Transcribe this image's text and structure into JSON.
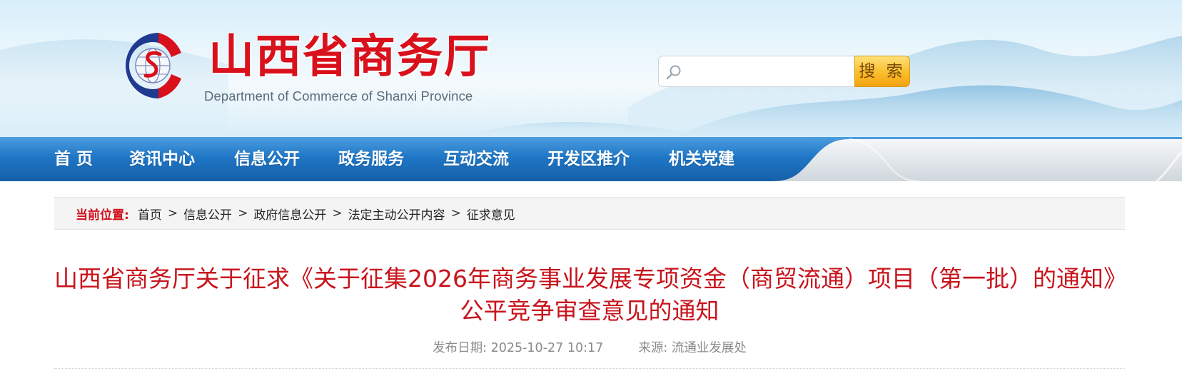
{
  "header": {
    "title": "山西省商务厅",
    "subtitle": "Department of Commerce of Shanxi Province",
    "logo_icon": "globe-s-emblem-icon",
    "search": {
      "placeholder": "",
      "value": "",
      "button_label": "搜 索",
      "icon": "search-icon"
    }
  },
  "nav": {
    "items": [
      {
        "label": "首  页"
      },
      {
        "label": "资讯中心"
      },
      {
        "label": "信息公开"
      },
      {
        "label": "政务服务"
      },
      {
        "label": "互动交流"
      },
      {
        "label": "开发区推介"
      },
      {
        "label": "机关党建"
      }
    ]
  },
  "breadcrumb": {
    "label": "当前位置:",
    "items": [
      "首页",
      "信息公开",
      "政府信息公开",
      "法定主动公开内容",
      "征求意见"
    ],
    "separator": ">"
  },
  "article": {
    "title_line1": "山西省商务厅关于征求《关于征集2026年商务事业发展专项资金（商贸流通）项目（第一批）的通知》",
    "title_line2": "公平竞争审查意见的通知",
    "date_label": "发布日期:",
    "date": "2025-10-27 10:17",
    "source_label": "来源:",
    "source": "流通业发展处"
  },
  "colors": {
    "brand_red": "#d9111c",
    "title_red": "#c8141c",
    "nav_blue": "#1a6fbf",
    "search_orange": "#fbbd2b",
    "meta_gray": "#8a8a8a"
  }
}
